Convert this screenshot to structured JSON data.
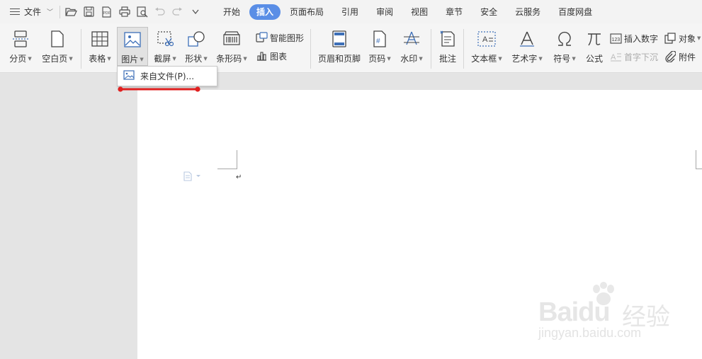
{
  "menu": {
    "file_label": "文件",
    "tabs": [
      "开始",
      "插入",
      "页面布局",
      "引用",
      "审阅",
      "视图",
      "章节",
      "安全",
      "云服务",
      "百度网盘"
    ],
    "active_tab": "插入"
  },
  "ribbon": {
    "page_break": "分页",
    "blank_page": "空白页",
    "table": "表格",
    "picture": "图片",
    "screenshot": "截屏",
    "shapes": "形状",
    "barcode": "条形码",
    "smart_art": "智能图形",
    "chart": "图表",
    "header_footer": "页眉和页脚",
    "page_number": "页码",
    "watermark": "水印",
    "comment": "批注",
    "text_box": "文本框",
    "word_art": "艺术字",
    "symbol": "符号",
    "formula": "公式",
    "insert_number": "插入数字",
    "object": "对象",
    "drop_cap": "首字下沉",
    "attachment": "附件"
  },
  "dropdown": {
    "from_file": "来自文件(P)..."
  },
  "watermark": {
    "brand": "Baidu",
    "brand_suffix": "经验",
    "site": "jingyan.baidu.com"
  },
  "colors": {
    "active_tab": "#5a8ee6",
    "annotation": "#e02020",
    "icon_blue": "#3d6fb8"
  }
}
